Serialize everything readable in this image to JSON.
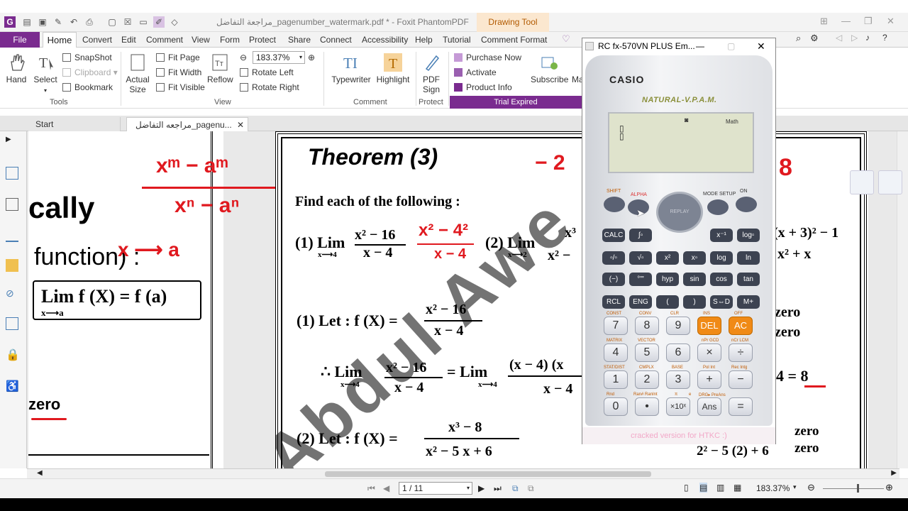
{
  "app": {
    "title": "مراجعة التفاضل_pagenumber_watermark.pdf * - Foxit PhantomPDF",
    "context_tab": "Drawing Tool"
  },
  "menu": {
    "file": "File",
    "items": [
      "Home",
      "Convert",
      "Edit",
      "Comment",
      "View",
      "Form",
      "Protect",
      "Share",
      "Connect",
      "Accessibility",
      "Help",
      "Tutorial",
      "Comment Format"
    ]
  },
  "ribbon": {
    "hand": "Hand",
    "select": "Select",
    "snapshot": "SnapShot",
    "clipboard": "Clipboard",
    "bookmark": "Bookmark",
    "actual_size": "Actual Size",
    "fit_page": "Fit Page",
    "fit_width": "Fit Width",
    "fit_visible": "Fit Visible",
    "reflow": "Reflow",
    "zoom": "183.37%",
    "rotate_left": "Rotate Left",
    "rotate_right": "Rotate Right",
    "typewriter": "Typewriter",
    "highlight": "Highlight",
    "pdf_sign": "PDF Sign",
    "purchase_now": "Purchase Now",
    "activate": "Activate",
    "product_info": "Product Info",
    "subscribe": "Subscribe",
    "ma": "Ma",
    "groups": {
      "tools": "Tools",
      "view": "View",
      "comment": "Comment",
      "protect": "Protect",
      "trial": "Trial Expired"
    }
  },
  "tabs": {
    "start": "Start",
    "doc": "مراجعه التفاضل_pagenu..."
  },
  "doc_left": {
    "cally": "cally",
    "function": "function) :",
    "lim_formula": "Lim f (X) = f (a)",
    "lim_sub": "x⟶a",
    "zero": "zero",
    "hw_top": "xᵐ − aᵐ",
    "hw_bottom": "xⁿ − aⁿ",
    "hw_arrow": "x ⟶ a"
  },
  "doc_main": {
    "theorem": "Theorem (3)",
    "find": "Find each of the following :",
    "q1": "(1) Lim",
    "q1_sub": "x⟶4",
    "q1_num": "x² − 16",
    "q1_den": "x − 4",
    "q1_hw_num": "x² − 4²",
    "q1_hw_den": "x − 4",
    "q2": "(2) Lim",
    "q2_sub": "x⟶2",
    "q2_num": "x³",
    "q2_den": "x² −",
    "q3_frag": "(x + 3)² − 1",
    "q3_den": "x² + x",
    "let1": "(1) Let : f (X) =",
    "let1_num": "x² − 16",
    "let1_den": "x − 4",
    "therefore": "∴ Lim",
    "th_num": "x² − 16",
    "th_den": "x − 4",
    "eq_lim": "= Lim",
    "eq_num": "(x − 4) (x",
    "eq_den": "x − 4",
    "result": "4 = 8",
    "result_hw": "8",
    "let2": "(2) Let : f (X) =",
    "let2_num": "x³ − 8",
    "let2_den": "x² − 5 x + 6",
    "zero_zero_num": "zero",
    "zero_zero_den": "zero",
    "last_den": "2² − 5 (2) + 6",
    "last_num": "zero",
    "last_zero": "zero",
    "hw_top_right": "− 2",
    "hw_top_right2": "8"
  },
  "status": {
    "page": "1 / 11",
    "zoom": "183.37%"
  },
  "calculator": {
    "title": "RC fx-570VN PLUS Em...",
    "brand": "CASIO",
    "subtitle": "NATURAL-V.P.A.M.",
    "lcd_indicator": "Math",
    "footer": "cracked version for HTKC :)",
    "top_labels": {
      "shift": "SHIFT",
      "alpha": "ALPHA",
      "mode": "MODE SETUP",
      "on": "ON"
    },
    "replay": "REPLAY",
    "row1": [
      "CALC",
      "∫▫",
      "x⁻¹",
      "log▫"
    ],
    "row2": [
      "▫/▫",
      "√▫",
      "x²",
      "x▫",
      "log",
      "ln"
    ],
    "row3": [
      "(−)",
      "°'\"",
      "hyp",
      "sin",
      "cos",
      "tan"
    ],
    "row4": [
      "RCL",
      "ENG",
      "(",
      ")",
      "S⇔D",
      "M+"
    ],
    "num_rows": [
      [
        "7",
        "8",
        "9",
        "DEL",
        "AC"
      ],
      [
        "4",
        "5",
        "6",
        "×",
        "÷"
      ],
      [
        "1",
        "2",
        "3",
        "+",
        "−"
      ],
      [
        "0",
        "•",
        "×10ˣ",
        "Ans",
        "="
      ]
    ],
    "small_labels": {
      "r1": [
        "CONST",
        "CONV",
        "CLR",
        "INS",
        "OFF"
      ],
      "r2": [
        "MATRIX",
        "VECTOR",
        "nPr GCD",
        "nCr LCM"
      ],
      "r3": [
        "STAT/DIST",
        "CMPLX",
        "BASE",
        "Pol Int",
        "Rec Intg"
      ],
      "r4": [
        "Rnd",
        "Ran# RanInt",
        "π",
        "e",
        "DRG▸ PreAns"
      ]
    }
  },
  "colors": {
    "accent": "#7a2b8f",
    "context_tab": "#fbe7cf",
    "annotation_red": "#e0191f",
    "calc_orange": "#f08a16"
  }
}
